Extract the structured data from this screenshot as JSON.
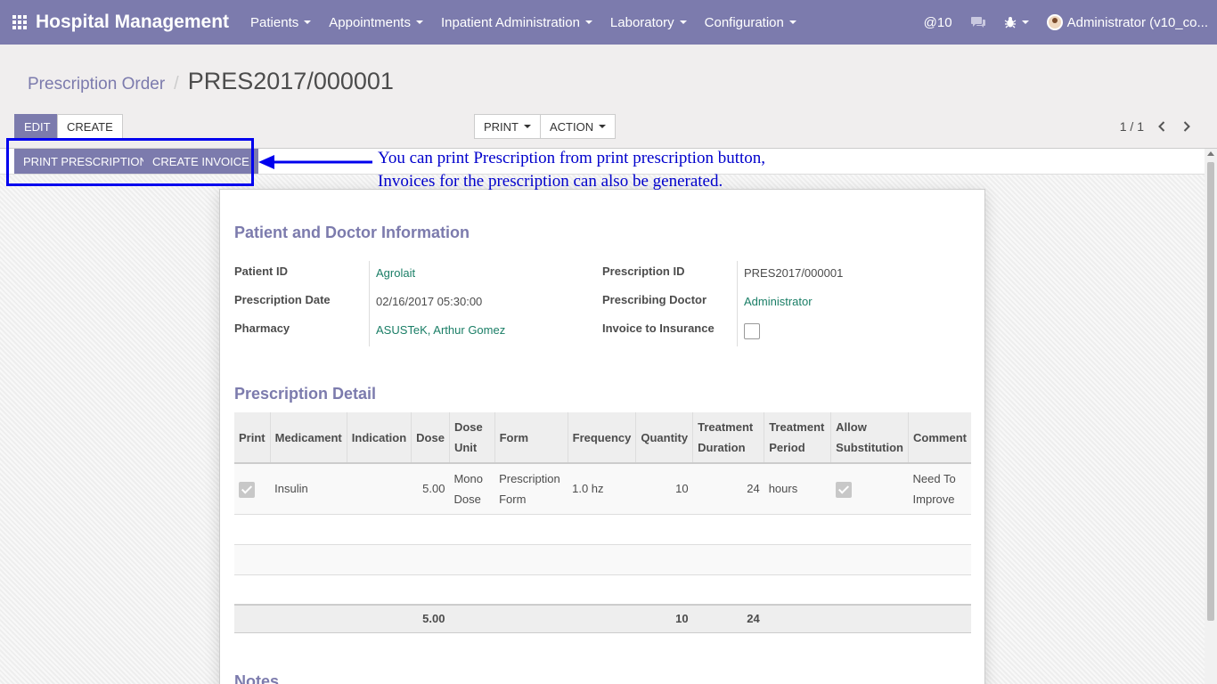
{
  "navbar": {
    "brand": "Hospital Management",
    "menu": [
      "Patients",
      "Appointments",
      "Inpatient Administration",
      "Laboratory",
      "Configuration"
    ],
    "mentions": "@10",
    "user": "Administrator (v10_co..."
  },
  "breadcrumb": {
    "parent": "Prescription Order",
    "current": "PRES2017/000001"
  },
  "buttons": {
    "edit": "EDIT",
    "create": "CREATE",
    "print": "PRINT",
    "action": "ACTION",
    "print_prescription": "PRINT PRESCRIPTION",
    "create_invoice": "CREATE INVOICE"
  },
  "pager": {
    "value": "1 / 1"
  },
  "annotation": {
    "line1": "You can print Prescription from print prescription button,",
    "line2": "Invoices for the prescription can also be generated."
  },
  "form": {
    "section1_title": "Patient and Doctor Information",
    "patient_id_label": "Patient ID",
    "patient_id": "Agrolait",
    "prescription_date_label": "Prescription Date",
    "prescription_date": "02/16/2017 05:30:00",
    "pharmacy_label": "Pharmacy",
    "pharmacy": "ASUSTeK, Arthur Gomez",
    "prescription_id_label": "Prescription ID",
    "prescription_id": "PRES2017/000001",
    "doctor_label": "Prescribing Doctor",
    "doctor": "Administrator",
    "insurance_label": "Invoice to Insurance",
    "insurance_checked": false,
    "section2_title": "Prescription Detail",
    "section3_title": "Notes"
  },
  "table": {
    "headers": {
      "print": "Print",
      "medicament": "Medicament",
      "indication": "Indication",
      "dose": "Dose",
      "dose_unit_1": "Dose",
      "dose_unit_2": "Unit",
      "form": "Form",
      "frequency": "Frequency",
      "quantity": "Quantity",
      "duration_1": "Treatment",
      "duration_2": "Duration",
      "period_1": "Treatment",
      "period_2": "Period",
      "subst_1": "Allow",
      "subst_2": "Substitution",
      "comment": "Comment"
    },
    "row": {
      "print": true,
      "medicament": "Insulin",
      "indication": "",
      "dose": "5.00",
      "dose_unit_1": "Mono",
      "dose_unit_2": "Dose",
      "form_1": "Prescription",
      "form_2": "Form",
      "frequency": "1.0 hz",
      "quantity": "10",
      "duration": "24",
      "period": "hours",
      "substitution": true,
      "comment_1": "Need To",
      "comment_2": "Improve"
    },
    "totals": {
      "dose": "5.00",
      "quantity": "10",
      "duration": "24"
    }
  }
}
